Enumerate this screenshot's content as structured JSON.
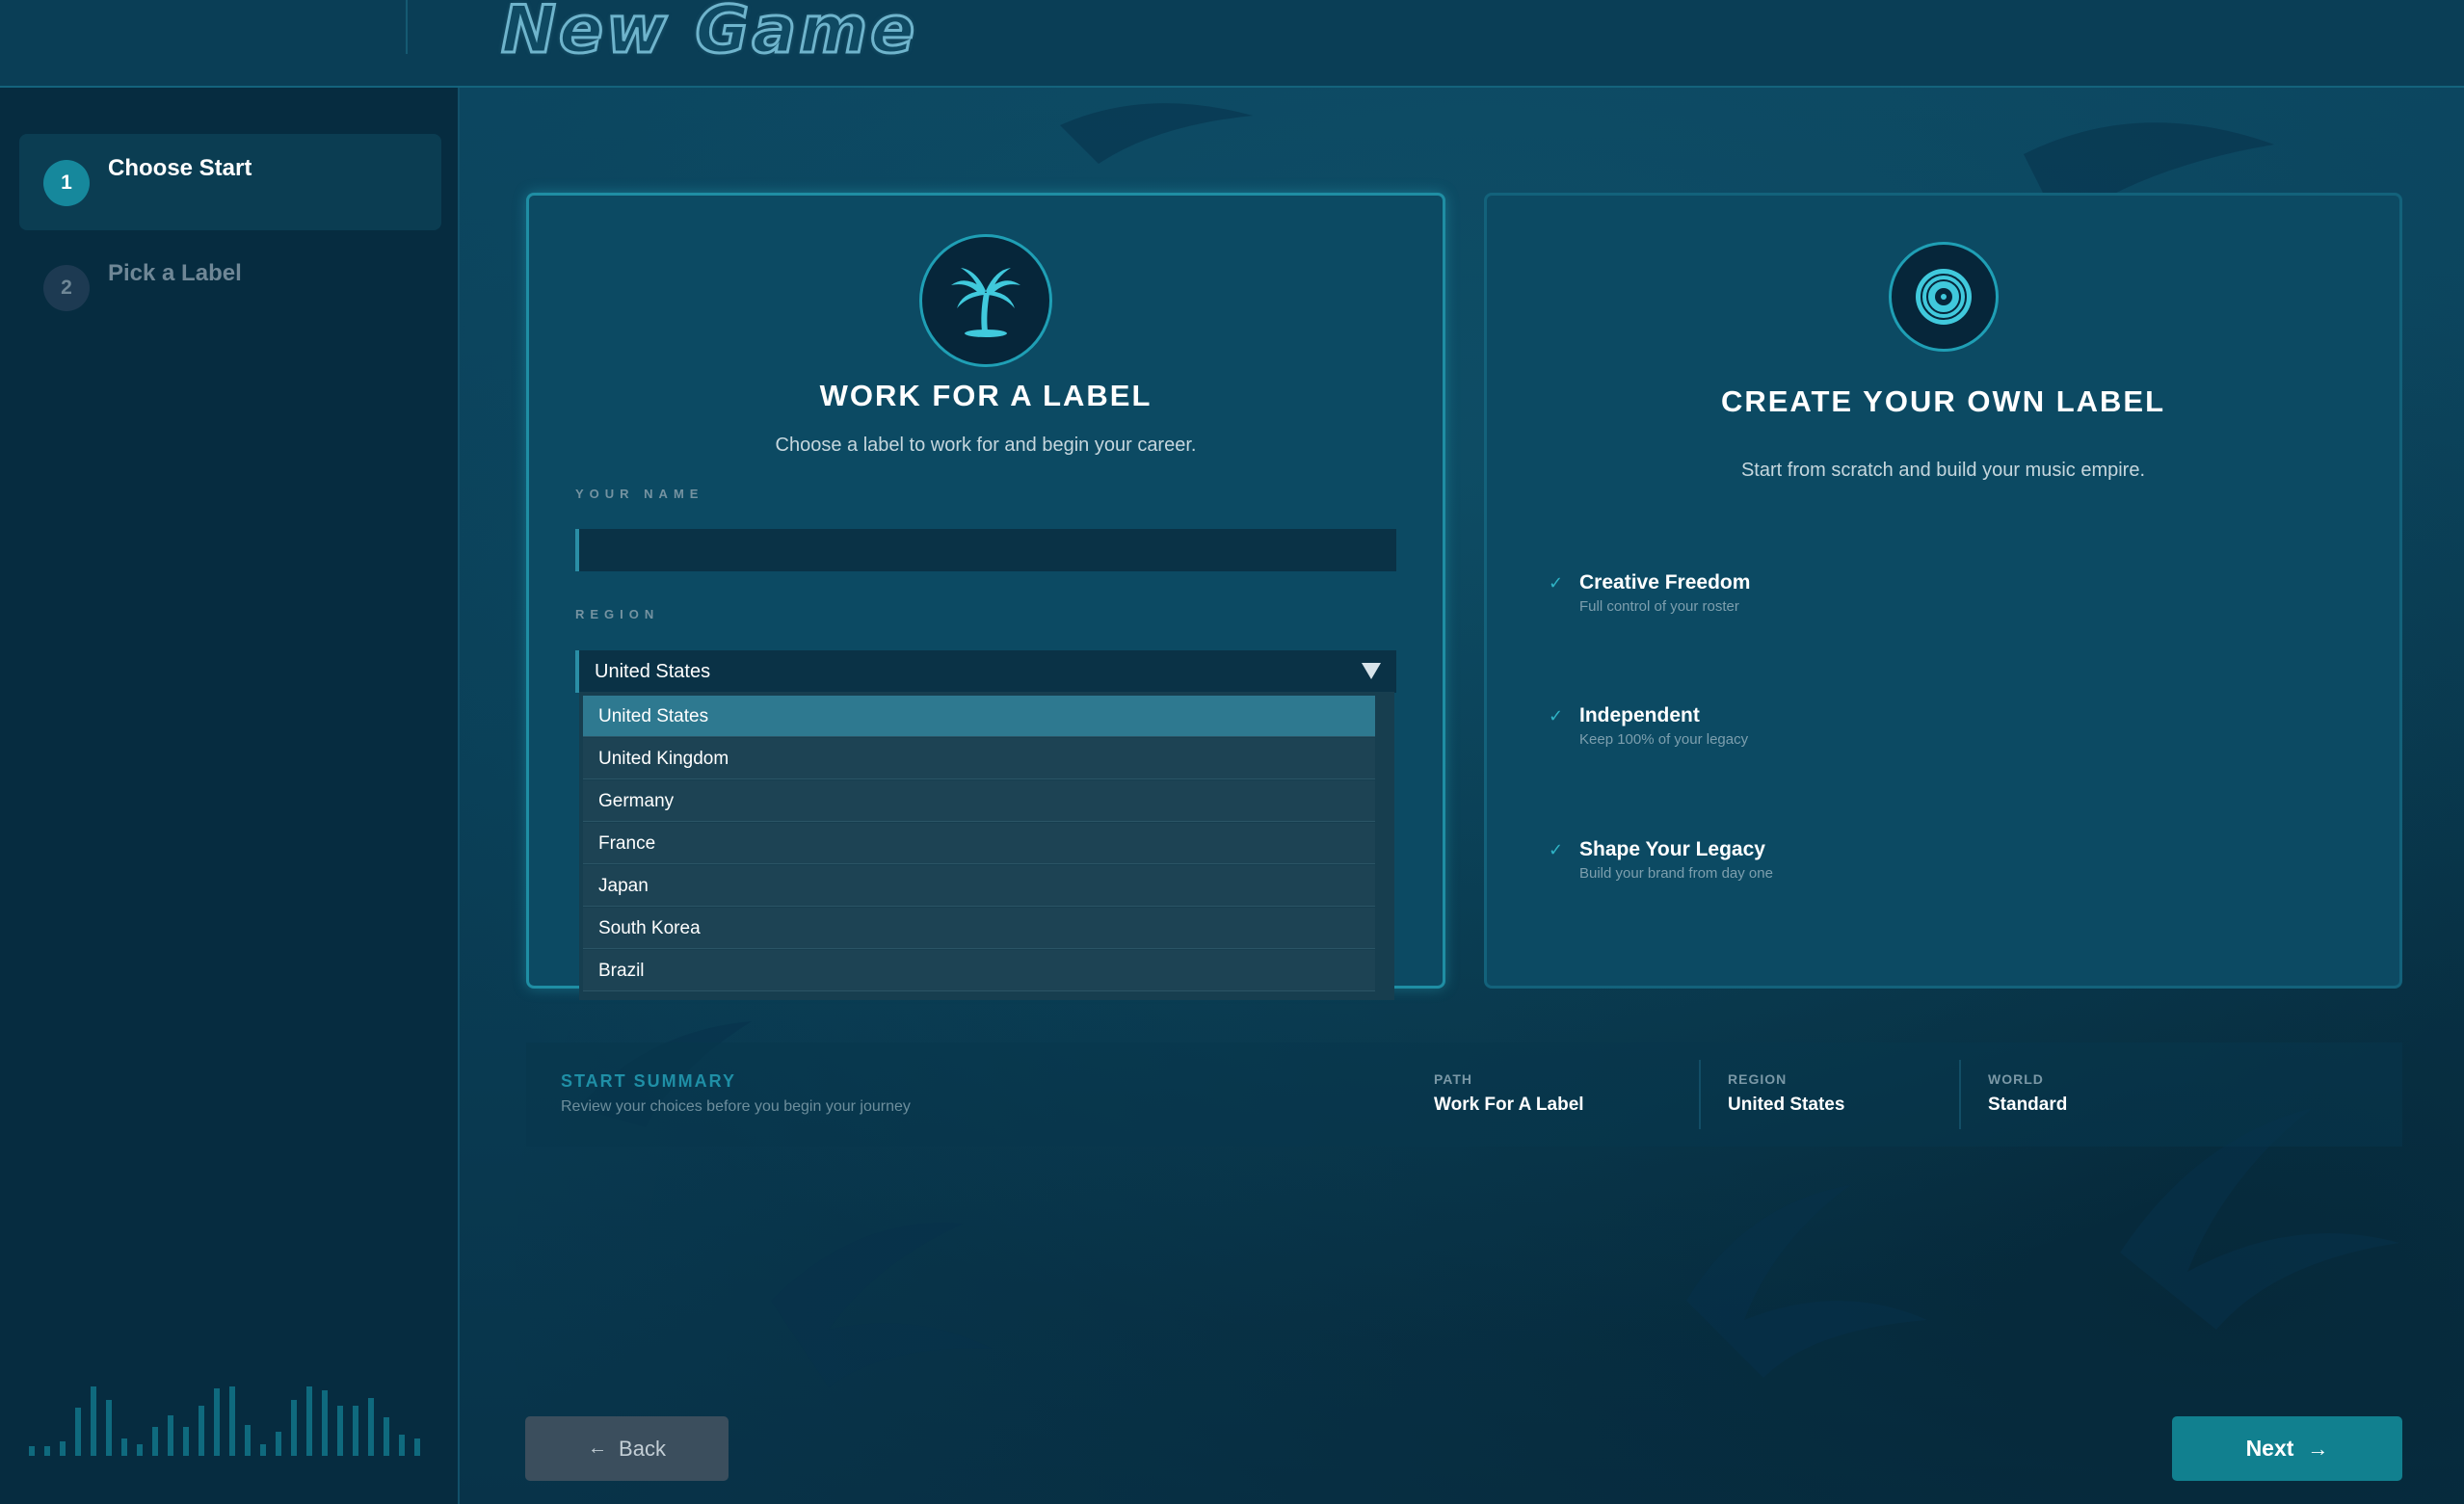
{
  "header": {
    "title": "New Game"
  },
  "sidebar": {
    "steps": [
      {
        "number": "1",
        "label": "Choose Start",
        "state": "active"
      },
      {
        "number": "2",
        "label": "Pick a Label",
        "state": "inactive"
      }
    ]
  },
  "work_card": {
    "icon": "palm-tree-icon",
    "title": "WORK FOR A LABEL",
    "subtitle": "Choose a label to work for and begin your career.",
    "name_label": "YOUR NAME",
    "name_value": "",
    "region_label": "REGION",
    "region_value": "United States",
    "region_options": [
      "United States",
      "United Kingdom",
      "Germany",
      "France",
      "Japan",
      "South Korea",
      "Brazil"
    ]
  },
  "own_card": {
    "icon": "vinyl-record-icon",
    "title": "CREATE YOUR OWN LABEL",
    "subtitle": "Start from scratch and build your music empire.",
    "features": [
      {
        "title": "Creative Freedom",
        "subtitle": "Full control of your roster"
      },
      {
        "title": "Independent",
        "subtitle": "Keep 100% of your legacy"
      },
      {
        "title": "Shape Your Legacy",
        "subtitle": "Build your brand from day one"
      }
    ]
  },
  "summary": {
    "title": "START SUMMARY",
    "subtitle": "Review your choices before you begin your journey",
    "path_label": "PATH",
    "path_value": "Work For A Label",
    "region_label": "REGION",
    "region_value": "United States",
    "world_label": "WORLD",
    "world_value": "Standard"
  },
  "buttons": {
    "back": "Back",
    "next": "Next"
  },
  "colors": {
    "accent": "#16889c",
    "background": "#0b3d52",
    "sidebar": "#062c40"
  }
}
